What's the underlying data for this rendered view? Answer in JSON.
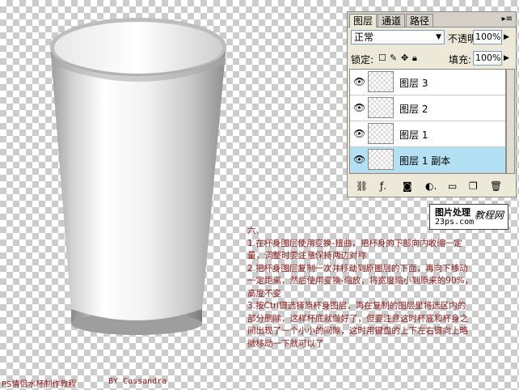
{
  "panel": {
    "tabs": [
      "图层",
      "通道",
      "路径"
    ],
    "blend_mode": "正常",
    "opacity_label": "不透明度:",
    "opacity_value": "100%",
    "lock_label": "锁定:",
    "fill_label": "填充:",
    "fill_value": "100%",
    "layers": [
      {
        "name": "图层 3",
        "visible": true,
        "selected": false
      },
      {
        "name": "图层 2",
        "visible": true,
        "selected": false
      },
      {
        "name": "图层 1",
        "visible": true,
        "selected": false
      },
      {
        "name": "图层 1 副本",
        "visible": true,
        "selected": true
      }
    ],
    "bottom_icons": [
      "link-icon",
      "style-icon",
      "mask-icon",
      "adjustment-icon",
      "group-icon",
      "new-layer-icon",
      "trash-icon"
    ]
  },
  "watermark": {
    "logo": "图片处理",
    "brand": "教程网",
    "site": "23ps.com"
  },
  "instructions": [
    "六、",
    "1.在杯身图层使用变换-扭曲，把杯身的下部向内收缩一定",
    "量，调整时要注意保持两边对称",
    "2.把杯身图层复制一次并移动到原图层的下面，再向下移动",
    "一定距离，然后使用变换-缩放，将宽度缩小到原来的90%，",
    "高度不变",
    "3.按Ctrl键选择原杯身图层，再在复制的图层里将选区内的",
    "部分删除，这样杯底就做好了，但要注意这时杯底和杯身之",
    "间出现了一个小小的间隙，这时用键盘的上下左右键向上略",
    "微移动一下就可以了"
  ],
  "footer": {
    "title": "PS情侣水杯制作教程",
    "author": "BY Cassandra"
  },
  "colors": {
    "text_red": "#8b1a1a",
    "selected_layer": "#b4e0f4",
    "panel_bg": "#ece9d8"
  }
}
